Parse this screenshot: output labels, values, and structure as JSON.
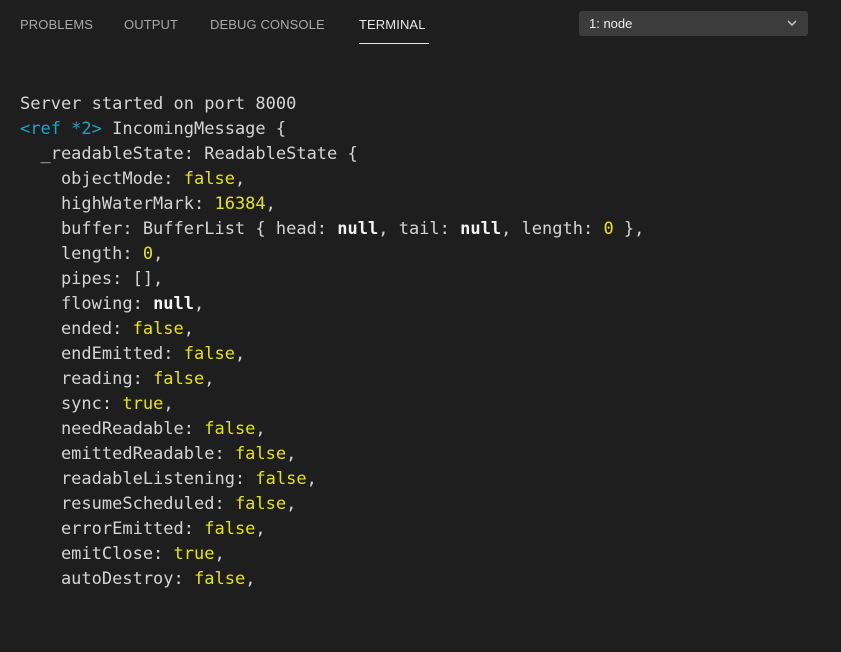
{
  "tabs": [
    {
      "label": "PROBLEMS",
      "active": false
    },
    {
      "label": "OUTPUT",
      "active": false
    },
    {
      "label": "DEBUG CONSOLE",
      "active": false
    },
    {
      "label": "TERMINAL",
      "active": true
    }
  ],
  "terminal_select": {
    "value": "1: node",
    "icon": "chevron-down-icon"
  },
  "colors": {
    "background": "#1e1e1e",
    "text": "#d4d4d4",
    "value_yellow": "#e5e510",
    "ref_cyan": "#11a8cd"
  },
  "terminal": {
    "lines": [
      {
        "segments": [
          {
            "text": "Server started on port 8000",
            "style": "normal"
          }
        ]
      },
      {
        "segments": [
          {
            "text": "<ref *2>",
            "style": "cyan"
          },
          {
            "text": " IncomingMessage {",
            "style": "normal"
          }
        ]
      },
      {
        "segments": [
          {
            "text": "  _readableState: ReadableState {",
            "style": "normal"
          }
        ]
      },
      {
        "segments": [
          {
            "text": "    objectMode: ",
            "style": "normal"
          },
          {
            "text": "false",
            "style": "yellow"
          },
          {
            "text": ",",
            "style": "normal"
          }
        ]
      },
      {
        "segments": [
          {
            "text": "    highWaterMark: ",
            "style": "normal"
          },
          {
            "text": "16384",
            "style": "yellow"
          },
          {
            "text": ",",
            "style": "normal"
          }
        ]
      },
      {
        "segments": [
          {
            "text": "    buffer: BufferList { head: ",
            "style": "normal"
          },
          {
            "text": "null",
            "style": "bold"
          },
          {
            "text": ", tail: ",
            "style": "normal"
          },
          {
            "text": "null",
            "style": "bold"
          },
          {
            "text": ", length: ",
            "style": "normal"
          },
          {
            "text": "0",
            "style": "yellow"
          },
          {
            "text": " },",
            "style": "normal"
          }
        ]
      },
      {
        "segments": [
          {
            "text": "    length: ",
            "style": "normal"
          },
          {
            "text": "0",
            "style": "yellow"
          },
          {
            "text": ",",
            "style": "normal"
          }
        ]
      },
      {
        "segments": [
          {
            "text": "    pipes: [],",
            "style": "normal"
          }
        ]
      },
      {
        "segments": [
          {
            "text": "    flowing: ",
            "style": "normal"
          },
          {
            "text": "null",
            "style": "bold"
          },
          {
            "text": ",",
            "style": "normal"
          }
        ]
      },
      {
        "segments": [
          {
            "text": "    ended: ",
            "style": "normal"
          },
          {
            "text": "false",
            "style": "yellow"
          },
          {
            "text": ",",
            "style": "normal"
          }
        ]
      },
      {
        "segments": [
          {
            "text": "    endEmitted: ",
            "style": "normal"
          },
          {
            "text": "false",
            "style": "yellow"
          },
          {
            "text": ",",
            "style": "normal"
          }
        ]
      },
      {
        "segments": [
          {
            "text": "    reading: ",
            "style": "normal"
          },
          {
            "text": "false",
            "style": "yellow"
          },
          {
            "text": ",",
            "style": "normal"
          }
        ]
      },
      {
        "segments": [
          {
            "text": "    sync: ",
            "style": "normal"
          },
          {
            "text": "true",
            "style": "yellow"
          },
          {
            "text": ",",
            "style": "normal"
          }
        ]
      },
      {
        "segments": [
          {
            "text": "    needReadable: ",
            "style": "normal"
          },
          {
            "text": "false",
            "style": "yellow"
          },
          {
            "text": ",",
            "style": "normal"
          }
        ]
      },
      {
        "segments": [
          {
            "text": "    emittedReadable: ",
            "style": "normal"
          },
          {
            "text": "false",
            "style": "yellow"
          },
          {
            "text": ",",
            "style": "normal"
          }
        ]
      },
      {
        "segments": [
          {
            "text": "    readableListening: ",
            "style": "normal"
          },
          {
            "text": "false",
            "style": "yellow"
          },
          {
            "text": ",",
            "style": "normal"
          }
        ]
      },
      {
        "segments": [
          {
            "text": "    resumeScheduled: ",
            "style": "normal"
          },
          {
            "text": "false",
            "style": "yellow"
          },
          {
            "text": ",",
            "style": "normal"
          }
        ]
      },
      {
        "segments": [
          {
            "text": "    errorEmitted: ",
            "style": "normal"
          },
          {
            "text": "false",
            "style": "yellow"
          },
          {
            "text": ",",
            "style": "normal"
          }
        ]
      },
      {
        "segments": [
          {
            "text": "    emitClose: ",
            "style": "normal"
          },
          {
            "text": "true",
            "style": "yellow"
          },
          {
            "text": ",",
            "style": "normal"
          }
        ]
      },
      {
        "segments": [
          {
            "text": "    autoDestroy: ",
            "style": "normal"
          },
          {
            "text": "false",
            "style": "yellow"
          },
          {
            "text": ",",
            "style": "normal"
          }
        ]
      }
    ]
  }
}
